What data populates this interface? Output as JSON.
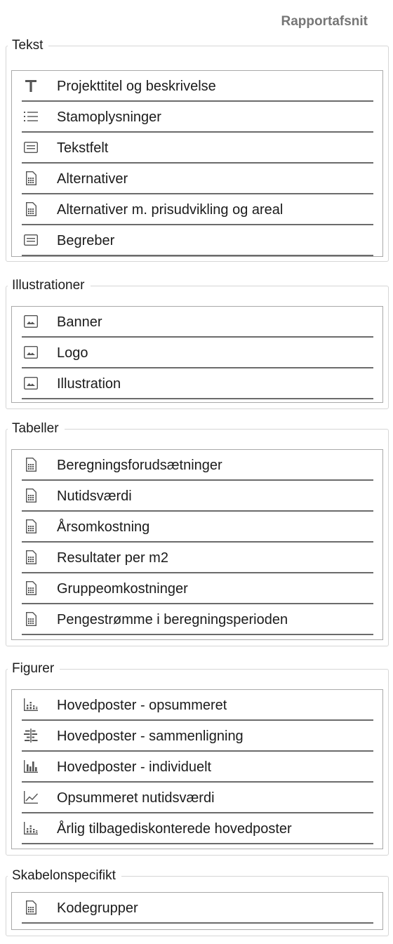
{
  "panel_title": "Rapportafsnit",
  "groups": [
    {
      "label": "Tekst",
      "items": [
        {
          "label": "Projekttitel og beskrivelse",
          "icon": "text-t-icon"
        },
        {
          "label": "Stamoplysninger",
          "icon": "list-icon"
        },
        {
          "label": "Tekstfelt",
          "icon": "textbox-icon"
        },
        {
          "label": "Alternativer",
          "icon": "document-table-icon"
        },
        {
          "label": "Alternativer m. prisudvikling og areal",
          "icon": "document-table-icon"
        },
        {
          "label": "Begreber",
          "icon": "textbox-icon"
        }
      ]
    },
    {
      "label": "Illustrationer",
      "items": [
        {
          "label": "Banner",
          "icon": "image-icon"
        },
        {
          "label": "Logo",
          "icon": "image-icon"
        },
        {
          "label": "Illustration",
          "icon": "image-icon"
        }
      ]
    },
    {
      "label": "Tabeller",
      "items": [
        {
          "label": "Beregningsforudsætninger",
          "icon": "document-table-icon"
        },
        {
          "label": "Nutidsværdi",
          "icon": "document-table-icon"
        },
        {
          "label": "Årsomkostning",
          "icon": "document-table-icon"
        },
        {
          "label": "Resultater per m2",
          "icon": "document-table-icon"
        },
        {
          "label": "Gruppeomkostninger",
          "icon": "document-table-icon"
        },
        {
          "label": "Pengestrømme i beregningsperioden",
          "icon": "document-table-icon"
        }
      ]
    },
    {
      "label": "Figurer",
      "items": [
        {
          "label": "Hovedposter - opsummeret",
          "icon": "stacked-bar-chart-icon"
        },
        {
          "label": "Hovedposter - sammenligning",
          "icon": "horizontal-bar-chart-icon"
        },
        {
          "label": "Hovedposter - individuelt",
          "icon": "bar-chart-icon"
        },
        {
          "label": "Opsummeret nutidsværdi",
          "icon": "line-chart-icon"
        },
        {
          "label": "Årlig tilbagediskonterede hovedposter",
          "icon": "stacked-bar-chart-icon"
        }
      ]
    },
    {
      "label": "Skabelonspecifikt",
      "items": [
        {
          "label": "Kodegrupper",
          "icon": "document-table-icon"
        }
      ]
    }
  ]
}
